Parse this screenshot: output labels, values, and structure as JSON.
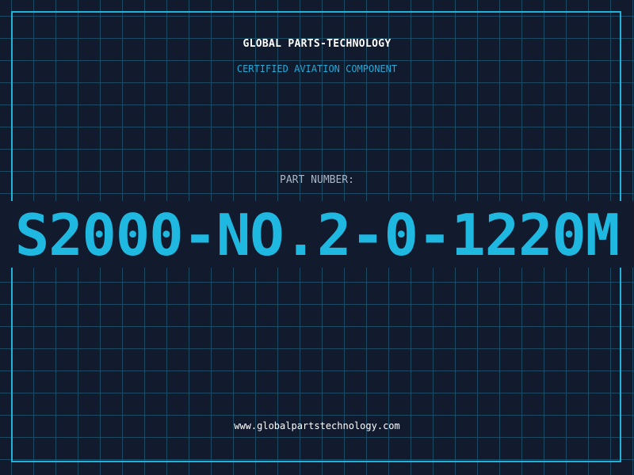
{
  "header": {
    "company_name": "GLOBAL PARTS-TECHNOLOGY",
    "subtitle": "CERTIFIED AVIATION COMPONENT"
  },
  "part": {
    "label": "PART NUMBER:",
    "number": "S2000-NO.2-0-1220M"
  },
  "footer": {
    "website": "www.globalpartstechnology.com"
  },
  "colors": {
    "background": "#121a2e",
    "grid": "#1c4a63",
    "accent": "#1fb8e0",
    "label": "#a9b7c6",
    "text": "#ffffff"
  }
}
